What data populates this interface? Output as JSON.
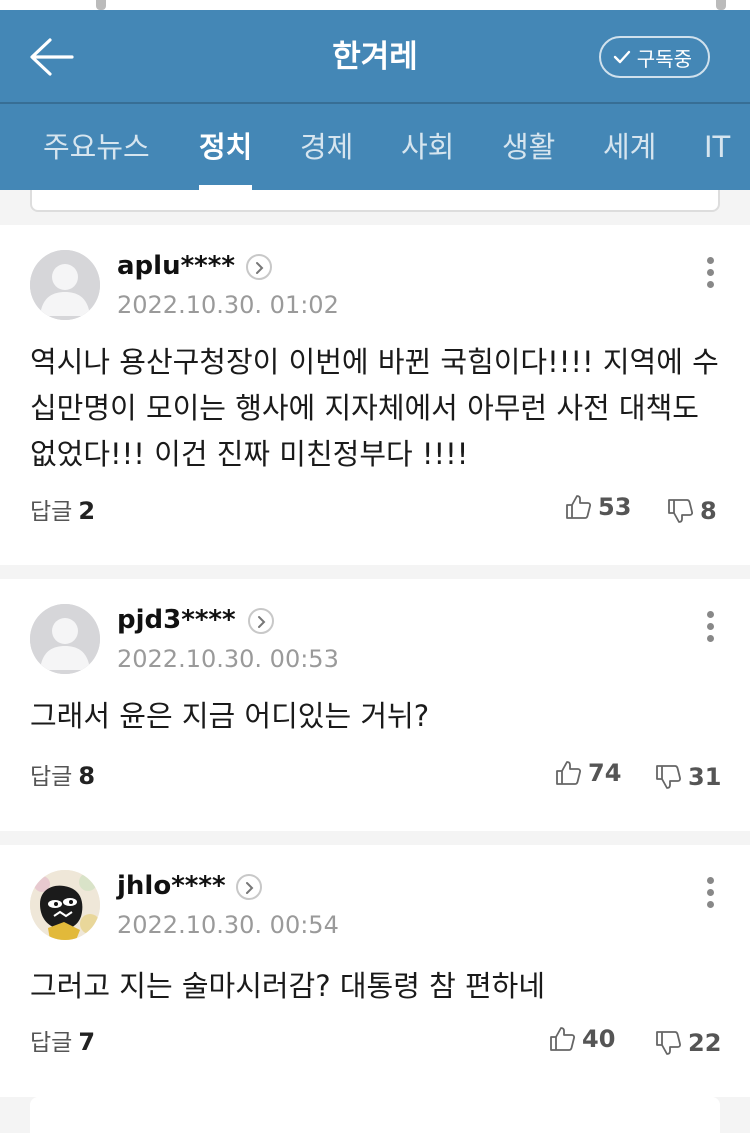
{
  "header": {
    "title": "한겨레",
    "subscribe_label": "구독중",
    "tabs": [
      {
        "label": "주요뉴스",
        "active": false
      },
      {
        "label": "정치",
        "active": true
      },
      {
        "label": "경제",
        "active": false
      },
      {
        "label": "사회",
        "active": false
      },
      {
        "label": "생활",
        "active": false
      },
      {
        "label": "세계",
        "active": false
      },
      {
        "label": "IT",
        "active": false
      }
    ],
    "colors": {
      "bar": "#4487b6",
      "text": "#ffffff"
    }
  },
  "comments": [
    {
      "username": "aplu****",
      "timestamp": "2022.10.30. 01:02",
      "text": "역시나 용산구청장이 이번에 바뀐 국힘이다!!!! 지역에 수십만명이 모이는 행사에 지자체에서 아무런 사전 대책도 없었다!!! 이건 진짜 미친정부다 !!!!",
      "reply_label": "답글",
      "reply_count": "2",
      "likes": "53",
      "dislikes": "8",
      "avatar": "default-avatar"
    },
    {
      "username": "pjd3****",
      "timestamp": "2022.10.30. 00:53",
      "text": "그래서 윤은 지금 어디있는 거뉘?",
      "reply_label": "답글",
      "reply_count": "8",
      "likes": "74",
      "dislikes": "31",
      "avatar": "default-avatar"
    },
    {
      "username": "jhlo****",
      "timestamp": "2022.10.30. 00:54",
      "text": "그러고 지는 술마시러감? 대통령 참 편하네",
      "reply_label": "답글",
      "reply_count": "7",
      "likes": "40",
      "dislikes": "22",
      "avatar": "custom-avatar"
    }
  ]
}
